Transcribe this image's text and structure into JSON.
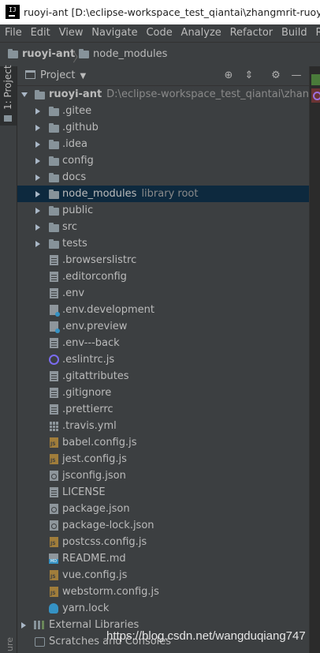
{
  "window": {
    "title": "ruoyi-ant [D:\\eclipse-workspace_test_qiantai\\zhangmrit-ruoyi-ant"
  },
  "menu": [
    "File",
    "Edit",
    "View",
    "Navigate",
    "Code",
    "Analyze",
    "Refactor",
    "Build",
    "Run"
  ],
  "breadcrumb": {
    "project": "ruoyi-ant",
    "folder": "node_modules"
  },
  "tool_window": {
    "tab_label": "1: Project",
    "bottom_label": "ure",
    "title": "Project"
  },
  "tree": {
    "root": {
      "name": "ruoyi-ant",
      "path": "D:\\eclipse-workspace_test_qiantai\\zhangmrit-r"
    },
    "folders": [
      ".gitee",
      ".github",
      ".idea",
      "config",
      "docs",
      "node_modules",
      "public",
      "src",
      "tests"
    ],
    "node_modules_tag": "library root",
    "files": [
      ".browserslistrc",
      ".editorconfig",
      ".env",
      ".env.development",
      ".env.preview",
      ".env---back",
      ".eslintrc.js",
      ".gitattributes",
      ".gitignore",
      ".prettierrc",
      ".travis.yml",
      "babel.config.js",
      "jest.config.js",
      "jsconfig.json",
      "LICENSE",
      "package.json",
      "package-lock.json",
      "postcss.config.js",
      "README.md",
      "vue.config.js",
      "webstorm.config.js",
      "yarn.lock"
    ],
    "external_libraries": "External Libraries",
    "scratches": "Scratches and Consoles"
  },
  "watermark": "https://blog.csdn.net/wangduqiang747",
  "colors": {
    "selection": "#0d293e",
    "background": "#3c3f41",
    "text": "#bbbbbb"
  }
}
